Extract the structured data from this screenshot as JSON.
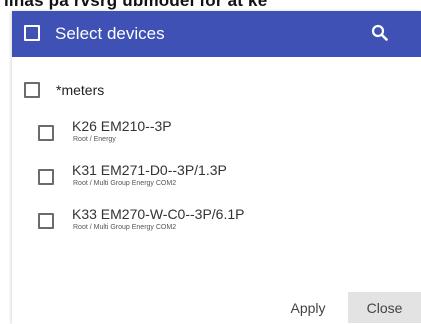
{
  "top_strip": {
    "text": "lihas pa rvsrg ubmodel for at ke"
  },
  "dialog": {
    "title": "Select devices",
    "search_icon": "search-icon",
    "header_color": "#3f51b5",
    "group": {
      "label": "*meters",
      "checked": false
    },
    "devices": [
      {
        "name": "K26 EM210--3P",
        "path": "Root / Energy",
        "checked": false
      },
      {
        "name": "K31 EM271-D0--3P/1.3P",
        "path": "Root / Multi Group Energy COM2",
        "checked": false
      },
      {
        "name": "K33 EM270-W-C0--3P/6.1P",
        "path": "Root / Multi Group Energy COM2",
        "checked": false
      }
    ],
    "buttons": {
      "apply": "Apply",
      "close": "Close"
    }
  }
}
